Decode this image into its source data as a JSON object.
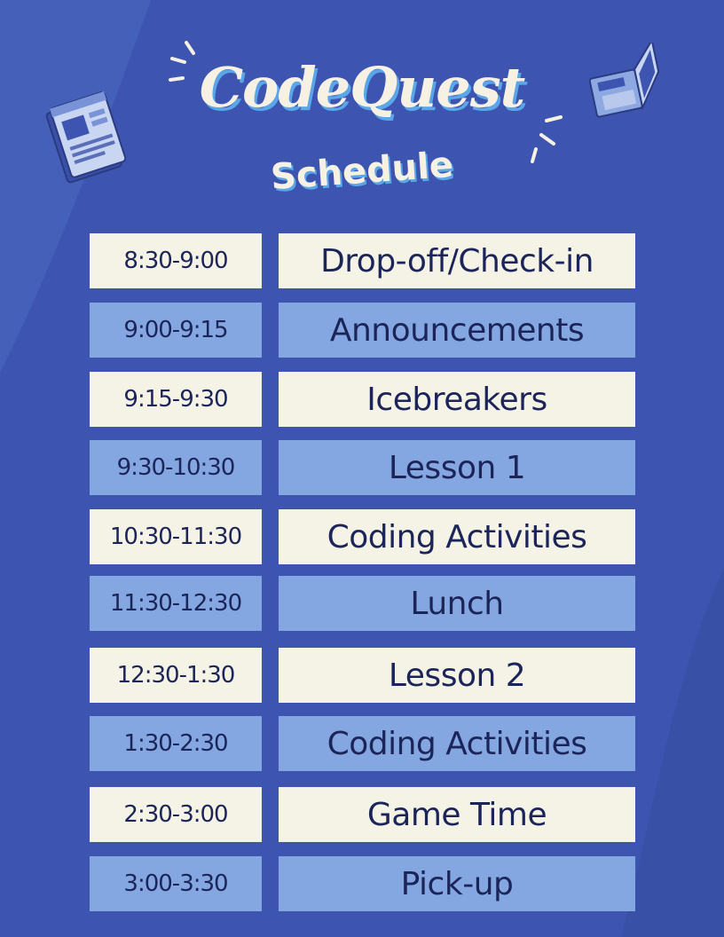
{
  "title": "CodeQuest",
  "subtitle": "Schedule",
  "colors": {
    "background": "#3d55b0",
    "light_cell": "#f5f2e6",
    "blue_cell": "#85a7e1",
    "text": "#1c2559"
  },
  "icons": [
    "browser-window-icon",
    "laptop-icon",
    "sparkle-lines-icon"
  ],
  "schedule": [
    {
      "time": "8:30-9:00",
      "activity": "Drop-off/Check-in",
      "style": "light"
    },
    {
      "time": "9:00-9:15",
      "activity": "Announcements",
      "style": "blue"
    },
    {
      "time": "9:15-9:30",
      "activity": "Icebreakers",
      "style": "light"
    },
    {
      "time": "9:30-10:30",
      "activity": "Lesson 1",
      "style": "blue"
    },
    {
      "time": "10:30-11:30",
      "activity": "Coding Activities",
      "style": "light"
    },
    {
      "time": "11:30-12:30",
      "activity": "Lunch",
      "style": "blue"
    },
    {
      "time": "12:30-1:30",
      "activity": "Lesson 2",
      "style": "light"
    },
    {
      "time": "1:30-2:30",
      "activity": "Coding Activities",
      "style": "blue"
    },
    {
      "time": "2:30-3:00",
      "activity": "Game Time",
      "style": "light"
    },
    {
      "time": "3:00-3:30",
      "activity": "Pick-up",
      "style": "blue"
    }
  ]
}
